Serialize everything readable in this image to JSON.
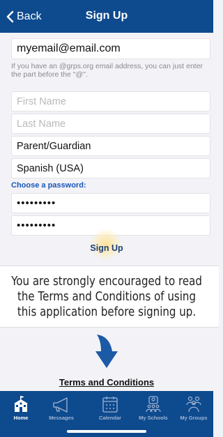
{
  "nav": {
    "back_label": "Back",
    "title": "Sign Up"
  },
  "form": {
    "email_value": "myemail@email.com",
    "email_hint": "If you have an @grps.org email address, you can just enter the part before the \"@\".",
    "first_name_placeholder": "First Name",
    "last_name_placeholder": "Last Name",
    "role_value": "Parent/Guardian",
    "language_value": "Spanish (USA)",
    "password_label": "Choose a password:",
    "password_value": "•••••••••",
    "confirm_password_value": "•••••••••",
    "submit_label": "Sign Up"
  },
  "callout": {
    "text": "You are strongly encouraged to read\nthe Terms and Conditions of using\nthis application before signing up."
  },
  "terms_link": "Terms and Conditions",
  "tabbar": {
    "items": [
      {
        "label": "Home",
        "icon": "school-house-icon",
        "active": true
      },
      {
        "label": "Messages",
        "icon": "megaphone-icon",
        "active": false
      },
      {
        "label": "Calendar",
        "icon": "calendar-icon",
        "active": false
      },
      {
        "label": "My Schools",
        "icon": "people-icon",
        "active": false
      },
      {
        "label": "My Groups",
        "icon": "group-icon",
        "active": false
      }
    ]
  },
  "colors": {
    "brand_blue": "#0e4a8e",
    "link_blue": "#1a56b8",
    "arrow_blue": "#1c5aa6",
    "background": "#f2f2f7"
  }
}
